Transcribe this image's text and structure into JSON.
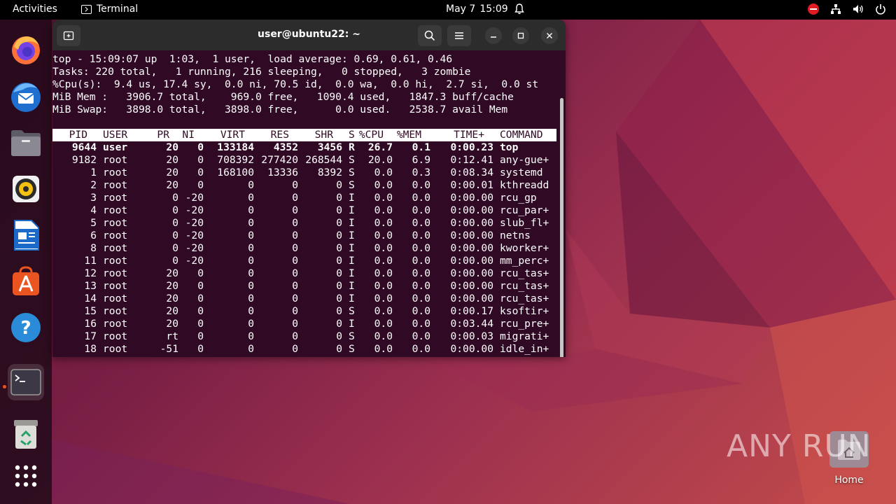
{
  "topbar": {
    "activities": "Activities",
    "app_name": "Terminal",
    "date": "May 7",
    "time": "15:09"
  },
  "dock": {
    "items": [
      "firefox",
      "thunderbird",
      "files",
      "rhythmbox",
      "libreoffice-writer",
      "app-center",
      "help",
      "terminal",
      "trash",
      "show-apps"
    ]
  },
  "terminal": {
    "title": "user@ubuntu22: ~",
    "summary": [
      "top - 15:09:07 up  1:03,  1 user,  load average: 0.69, 0.61, 0.46",
      "Tasks: 220 total,   1 running, 216 sleeping,   0 stopped,   3 zombie",
      "%Cpu(s):  9.4 us, 17.4 sy,  0.0 ni, 70.5 id,  0.0 wa,  0.0 hi,  2.7 si,  0.0 st",
      "MiB Mem :   3906.7 total,    969.0 free,   1090.4 used,   1847.3 buff/cache",
      "MiB Swap:   3898.0 total,   3898.0 free,      0.0 used.   2538.7 avail Mem"
    ],
    "columns": [
      "PID",
      "USER",
      "PR",
      "NI",
      "VIRT",
      "RES",
      "SHR",
      "S",
      "%CPU",
      "%MEM",
      "TIME+",
      "COMMAND"
    ],
    "processes": [
      [
        "9644",
        "user",
        "20",
        "0",
        "133184",
        "4352",
        "3456",
        "R",
        "26.7",
        "0.1",
        "0:00.23",
        "top"
      ],
      [
        "9182",
        "root",
        "20",
        "0",
        "708392",
        "277420",
        "268544",
        "S",
        "20.0",
        "6.9",
        "0:12.41",
        "any-gue+"
      ],
      [
        "1",
        "root",
        "20",
        "0",
        "168100",
        "13336",
        "8392",
        "S",
        "0.0",
        "0.3",
        "0:08.34",
        "systemd"
      ],
      [
        "2",
        "root",
        "20",
        "0",
        "0",
        "0",
        "0",
        "S",
        "0.0",
        "0.0",
        "0:00.01",
        "kthreadd"
      ],
      [
        "3",
        "root",
        "0",
        "-20",
        "0",
        "0",
        "0",
        "I",
        "0.0",
        "0.0",
        "0:00.00",
        "rcu_gp"
      ],
      [
        "4",
        "root",
        "0",
        "-20",
        "0",
        "0",
        "0",
        "I",
        "0.0",
        "0.0",
        "0:00.00",
        "rcu_par+"
      ],
      [
        "5",
        "root",
        "0",
        "-20",
        "0",
        "0",
        "0",
        "I",
        "0.0",
        "0.0",
        "0:00.00",
        "slub_fl+"
      ],
      [
        "6",
        "root",
        "0",
        "-20",
        "0",
        "0",
        "0",
        "I",
        "0.0",
        "0.0",
        "0:00.00",
        "netns"
      ],
      [
        "8",
        "root",
        "0",
        "-20",
        "0",
        "0",
        "0",
        "I",
        "0.0",
        "0.0",
        "0:00.00",
        "kworker+"
      ],
      [
        "11",
        "root",
        "0",
        "-20",
        "0",
        "0",
        "0",
        "I",
        "0.0",
        "0.0",
        "0:00.00",
        "mm_perc+"
      ],
      [
        "12",
        "root",
        "20",
        "0",
        "0",
        "0",
        "0",
        "I",
        "0.0",
        "0.0",
        "0:00.00",
        "rcu_tas+"
      ],
      [
        "13",
        "root",
        "20",
        "0",
        "0",
        "0",
        "0",
        "I",
        "0.0",
        "0.0",
        "0:00.00",
        "rcu_tas+"
      ],
      [
        "14",
        "root",
        "20",
        "0",
        "0",
        "0",
        "0",
        "I",
        "0.0",
        "0.0",
        "0:00.00",
        "rcu_tas+"
      ],
      [
        "15",
        "root",
        "20",
        "0",
        "0",
        "0",
        "0",
        "S",
        "0.0",
        "0.0",
        "0:00.17",
        "ksoftir+"
      ],
      [
        "16",
        "root",
        "20",
        "0",
        "0",
        "0",
        "0",
        "I",
        "0.0",
        "0.0",
        "0:03.44",
        "rcu_pre+"
      ],
      [
        "17",
        "root",
        "rt",
        "0",
        "0",
        "0",
        "0",
        "S",
        "0.0",
        "0.0",
        "0:00.03",
        "migrati+"
      ],
      [
        "18",
        "root",
        "-51",
        "0",
        "0",
        "0",
        "0",
        "S",
        "0.0",
        "0.0",
        "0:00.00",
        "idle_in+"
      ]
    ]
  },
  "desktop": {
    "home_label": "Home",
    "watermark": "ANY RUN"
  },
  "colors": {
    "terminal_bg": "#300a24",
    "accent": "#e95420"
  }
}
